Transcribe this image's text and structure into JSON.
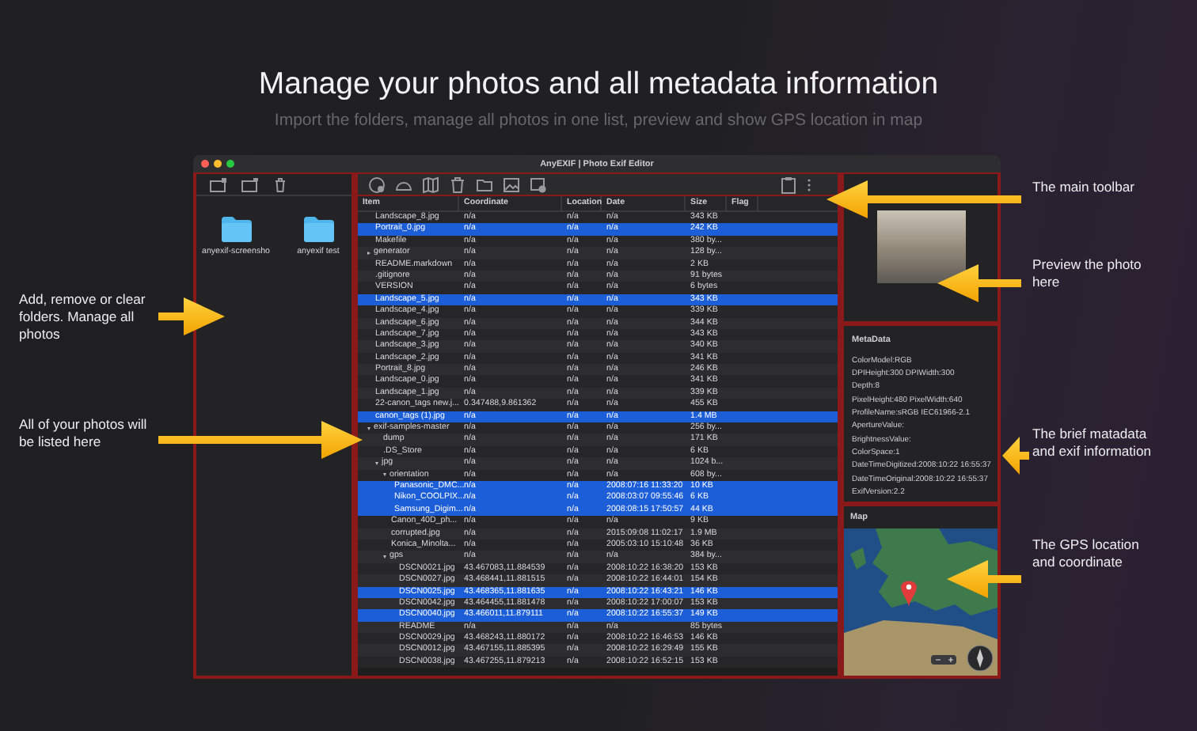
{
  "headline": "Manage your photos and all metadata information",
  "subheadline": "Import the folders, manage all photos in one list, preview and show GPS location in map",
  "window": {
    "title": "AnyEXIF | Photo Exif Editor"
  },
  "sidebar": {
    "folders": [
      {
        "label": "anyexif-screensho"
      },
      {
        "label": "anyexif test"
      }
    ]
  },
  "table": {
    "columns": [
      "Item",
      "Coordinate",
      "Location",
      "Date",
      "Size",
      "Flag"
    ],
    "rows": [
      {
        "item": "Landscape_8.jpg",
        "coordinate": "n/a",
        "location": "n/a",
        "date": "n/a",
        "size": "343 KB",
        "selected": false
      },
      {
        "item": "Portrait_0.jpg",
        "coordinate": "n/a",
        "location": "n/a",
        "date": "n/a",
        "size": "242 KB",
        "selected": true
      },
      {
        "item": "Makefile",
        "coordinate": "n/a",
        "location": "n/a",
        "date": "n/a",
        "size": "380 by...",
        "selected": false
      },
      {
        "item": "generator",
        "coordinate": "n/a",
        "location": "n/a",
        "date": "n/a",
        "size": "128 by...",
        "selected": false,
        "expanded": false
      },
      {
        "item": "README.markdown",
        "coordinate": "n/a",
        "location": "n/a",
        "date": "n/a",
        "size": "2 KB",
        "selected": false
      },
      {
        "item": ".gitignore",
        "coordinate": "n/a",
        "location": "n/a",
        "date": "n/a",
        "size": "91 bytes",
        "selected": false
      },
      {
        "item": "VERSION",
        "coordinate": "n/a",
        "location": "n/a",
        "date": "n/a",
        "size": "6 bytes",
        "selected": false
      },
      {
        "item": "Landscape_5.jpg",
        "coordinate": "n/a",
        "location": "n/a",
        "date": "n/a",
        "size": "343 KB",
        "selected": true
      },
      {
        "item": "Landscape_4.jpg",
        "coordinate": "n/a",
        "location": "n/a",
        "date": "n/a",
        "size": "339 KB",
        "selected": false
      },
      {
        "item": "Landscape_6.jpg",
        "coordinate": "n/a",
        "location": "n/a",
        "date": "n/a",
        "size": "344 KB",
        "selected": false
      },
      {
        "item": "Landscape_7.jpg",
        "coordinate": "n/a",
        "location": "n/a",
        "date": "n/a",
        "size": "343 KB",
        "selected": false
      },
      {
        "item": "Landscape_3.jpg",
        "coordinate": "n/a",
        "location": "n/a",
        "date": "n/a",
        "size": "340 KB",
        "selected": false
      },
      {
        "item": "Landscape_2.jpg",
        "coordinate": "n/a",
        "location": "n/a",
        "date": "n/a",
        "size": "341 KB",
        "selected": false
      },
      {
        "item": "Portrait_8.jpg",
        "coordinate": "n/a",
        "location": "n/a",
        "date": "n/a",
        "size": "246 KB",
        "selected": false
      },
      {
        "item": "Landscape_0.jpg",
        "coordinate": "n/a",
        "location": "n/a",
        "date": "n/a",
        "size": "341 KB",
        "selected": false
      },
      {
        "item": "Landscape_1.jpg",
        "coordinate": "n/a",
        "location": "n/a",
        "date": "n/a",
        "size": "339 KB",
        "selected": false
      },
      {
        "item": "22-canon_tags new.j...",
        "coordinate": "0.347488,9.861362",
        "location": "n/a",
        "date": "n/a",
        "size": "455 KB",
        "selected": false
      },
      {
        "item": "canon_tags (1).jpg",
        "coordinate": "n/a",
        "location": "n/a",
        "date": "n/a",
        "size": "1.4 MB",
        "selected": true
      },
      {
        "item": "exif-samples-master",
        "coordinate": "n/a",
        "location": "n/a",
        "date": "n/a",
        "size": "256 by...",
        "selected": false,
        "expanded": true,
        "children": [
          {
            "item": "dump",
            "coordinate": "n/a",
            "location": "n/a",
            "date": "n/a",
            "size": "171 KB",
            "selected": false
          },
          {
            "item": ".DS_Store",
            "coordinate": "n/a",
            "location": "n/a",
            "date": "n/a",
            "size": "6 KB",
            "selected": false
          },
          {
            "item": "jpg",
            "coordinate": "n/a",
            "location": "n/a",
            "date": "n/a",
            "size": "1024 b...",
            "selected": false,
            "expanded": true,
            "children": [
              {
                "item": "orientation",
                "coordinate": "n/a",
                "location": "n/a",
                "date": "n/a",
                "size": "608 by...",
                "selected": false,
                "expanded": true,
                "children": [
                  {
                    "item": "Panasonic_DMC...",
                    "coordinate": "n/a",
                    "location": "n/a",
                    "date": "2008:07:16 11:33:20",
                    "size": "10 KB",
                    "selected": true
                  },
                  {
                    "item": "Nikon_COOLPIX...",
                    "coordinate": "n/a",
                    "location": "n/a",
                    "date": "2008:03:07 09:55:46",
                    "size": "6 KB",
                    "selected": true
                  },
                  {
                    "item": "Samsung_Digim...",
                    "coordinate": "n/a",
                    "location": "n/a",
                    "date": "2008:08:15 17:50:57",
                    "size": "44 KB",
                    "selected": true
                  }
                ]
              },
              {
                "item": "Canon_40D_ph...",
                "coordinate": "n/a",
                "location": "n/a",
                "date": "n/a",
                "size": "9 KB",
                "selected": false
              },
              {
                "item": "corrupted.jpg",
                "coordinate": "n/a",
                "location": "n/a",
                "date": "2015:09:08 11:02:17",
                "size": "1.9 MB",
                "selected": false
              },
              {
                "item": "Konica_Minolta...",
                "coordinate": "n/a",
                "location": "n/a",
                "date": "2005:03:10 15:10:48",
                "size": "36 KB",
                "selected": false
              },
              {
                "item": "gps",
                "coordinate": "n/a",
                "location": "n/a",
                "date": "n/a",
                "size": "384 by...",
                "selected": false,
                "expanded": true,
                "children": [
                  {
                    "item": "DSCN0021.jpg",
                    "coordinate": "43.467083,11.884539",
                    "location": "n/a",
                    "date": "2008:10:22 16:38:20",
                    "size": "153 KB",
                    "selected": false
                  },
                  {
                    "item": "DSCN0027.jpg",
                    "coordinate": "43.468441,11.881515",
                    "location": "n/a",
                    "date": "2008:10:22 16:44:01",
                    "size": "154 KB",
                    "selected": false
                  },
                  {
                    "item": "DSCN0025.jpg",
                    "coordinate": "43.468365,11.881635",
                    "location": "n/a",
                    "date": "2008:10:22 16:43:21",
                    "size": "146 KB",
                    "selected": true
                  },
                  {
                    "item": "DSCN0042.jpg",
                    "coordinate": "43.464455,11.881478",
                    "location": "n/a",
                    "date": "2008:10:22 17:00:07",
                    "size": "153 KB",
                    "selected": false
                  },
                  {
                    "item": "DSCN0040.jpg",
                    "coordinate": "43.466011,11.879111",
                    "location": "n/a",
                    "date": "2008:10:22 16:55:37",
                    "size": "149 KB",
                    "selected": true
                  },
                  {
                    "item": "README",
                    "coordinate": "n/a",
                    "location": "n/a",
                    "date": "n/a",
                    "size": "85 bytes",
                    "selected": false
                  },
                  {
                    "item": "DSCN0029.jpg",
                    "coordinate": "43.468243,11.880172",
                    "location": "n/a",
                    "date": "2008:10:22 16:46:53",
                    "size": "146 KB",
                    "selected": false
                  },
                  {
                    "item": "DSCN0012.jpg",
                    "coordinate": "43.467155,11.885395",
                    "location": "n/a",
                    "date": "2008:10:22 16:29:49",
                    "size": "155 KB",
                    "selected": false
                  },
                  {
                    "item": "DSCN0038.jpg",
                    "coordinate": "43.467255,11.879213",
                    "location": "n/a",
                    "date": "2008:10:22 16:52:15",
                    "size": "153 KB",
                    "selected": false
                  }
                ]
              }
            ]
          }
        ]
      }
    ]
  },
  "metadata": {
    "title": "MetaData",
    "lines": [
      "ColorModel:RGB",
      "DPIHeight:300  DPIWidth:300",
      "Depth:8",
      "PixelHeight:480  PixelWidth:640",
      "ProfileName:sRGB IEC61966-2.1",
      "ApertureValue:",
      "BrightnessValue:",
      "ColorSpace:1",
      "DateTimeDigitized:2008:10:22 16:55:37",
      "DateTimeOriginal:2008:10:22 16:55:37",
      "ExifVersion:2.2"
    ]
  },
  "map": {
    "title": "Map"
  },
  "left_notes": [
    "Add, remove or clear folders. Manage all photos",
    "All of your photos will be listed here"
  ],
  "right_notes": [
    "The main toolbar",
    "Preview the photo here",
    "The brief matadata and exif information",
    "The GPS  location and coordinate"
  ]
}
